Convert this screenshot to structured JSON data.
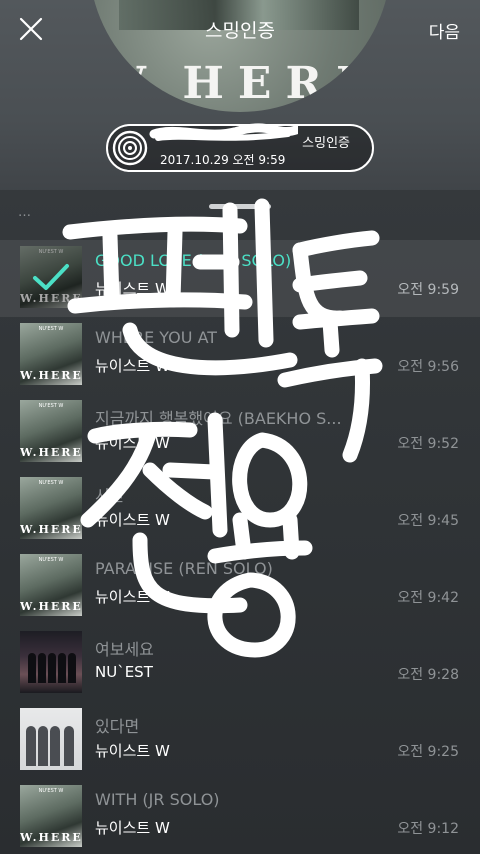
{
  "header": {
    "title": "스밍인증",
    "next_label": "다음",
    "album_wordmark": "W.HERE"
  },
  "badge": {
    "title": "스밍인증",
    "datetime": "2017.10.29 오전 9:59"
  },
  "list": {
    "partial_text": "…",
    "songs": [
      {
        "title": "GOOD LOVE (REN SOLO)",
        "artist": "뉴이스트 W",
        "time": "오전 9:59",
        "thumb": "where",
        "active": true
      },
      {
        "title": "WHERE YOU AT",
        "artist": "뉴이스트 W",
        "time": "오전 9:56",
        "thumb": "where"
      },
      {
        "title": "지금까지 행복했어요 (BAEKHO S...",
        "artist": "뉴이스트 W",
        "time": "오전 9:52",
        "thumb": "where"
      },
      {
        "title": "시간",
        "artist": "뉴이스트 W",
        "time": "오전 9:45",
        "thumb": "where"
      },
      {
        "title": "PARADISE (REN SOLO)",
        "artist": "뉴이스트 W",
        "time": "오전 9:42",
        "thumb": "where"
      },
      {
        "title": "여보세요",
        "artist": "NU`EST",
        "time": "오전 9:28",
        "thumb": "hello"
      },
      {
        "title": "있다면",
        "artist": "뉴이스트 W",
        "time": "오전 9:25",
        "thumb": "itda"
      },
      {
        "title": "WITH (JR SOLO)",
        "artist": "뉴이스트 W",
        "time": "오전 9:12",
        "thumb": "where"
      }
    ],
    "thumb_label": "W.HERE",
    "thumb_tiny": "NU'EST W"
  },
  "colors": {
    "accent": "#4be0c6",
    "muted": "#8f9396",
    "background": "#2b2e31"
  },
  "icons": {
    "close": "close-icon",
    "record": "vinyl-record-icon",
    "check": "check-icon"
  }
}
